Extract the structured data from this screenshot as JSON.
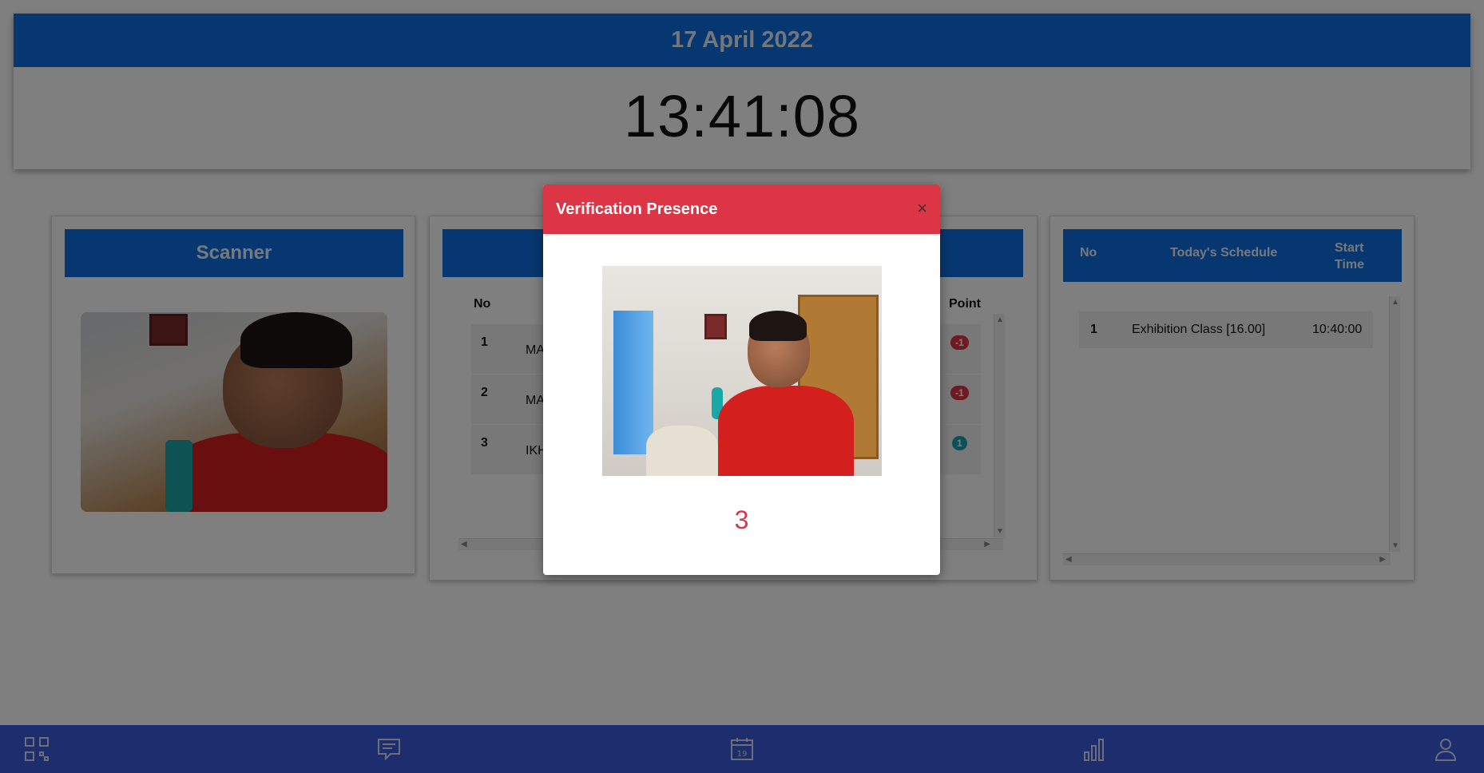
{
  "header": {
    "date": "17 April 2022",
    "time": "13:41:08"
  },
  "scanner": {
    "title": "Scanner"
  },
  "attendance": {
    "columns": {
      "no": "No",
      "point": "Point"
    },
    "rows": [
      {
        "no": "1",
        "name": "MA",
        "point": "-1",
        "badge_color": "#dc3545"
      },
      {
        "no": "2",
        "name": "MA",
        "point": "-1",
        "badge_color": "#dc3545"
      },
      {
        "no": "3",
        "name": "IKH",
        "point": "1",
        "badge_color": "#17a2b8"
      }
    ]
  },
  "schedule": {
    "columns": {
      "no": "No",
      "title": "Today's Schedule",
      "start": "Start Time"
    },
    "rows": [
      {
        "no": "1",
        "title": "Exhibition Class [16.00]",
        "start": "10:40:00"
      }
    ]
  },
  "modal": {
    "title": "Verification Presence",
    "close_icon": "×",
    "number": "3"
  },
  "nav": {
    "items": [
      "qr-code-icon",
      "message-icon",
      "calendar-icon",
      "chart-icon",
      "user-icon"
    ],
    "calendar_day": "19"
  },
  "colors": {
    "primary": "#0f6fe0",
    "danger": "#dc3545",
    "info": "#17a2b8",
    "nav": "#3b5bdb"
  }
}
